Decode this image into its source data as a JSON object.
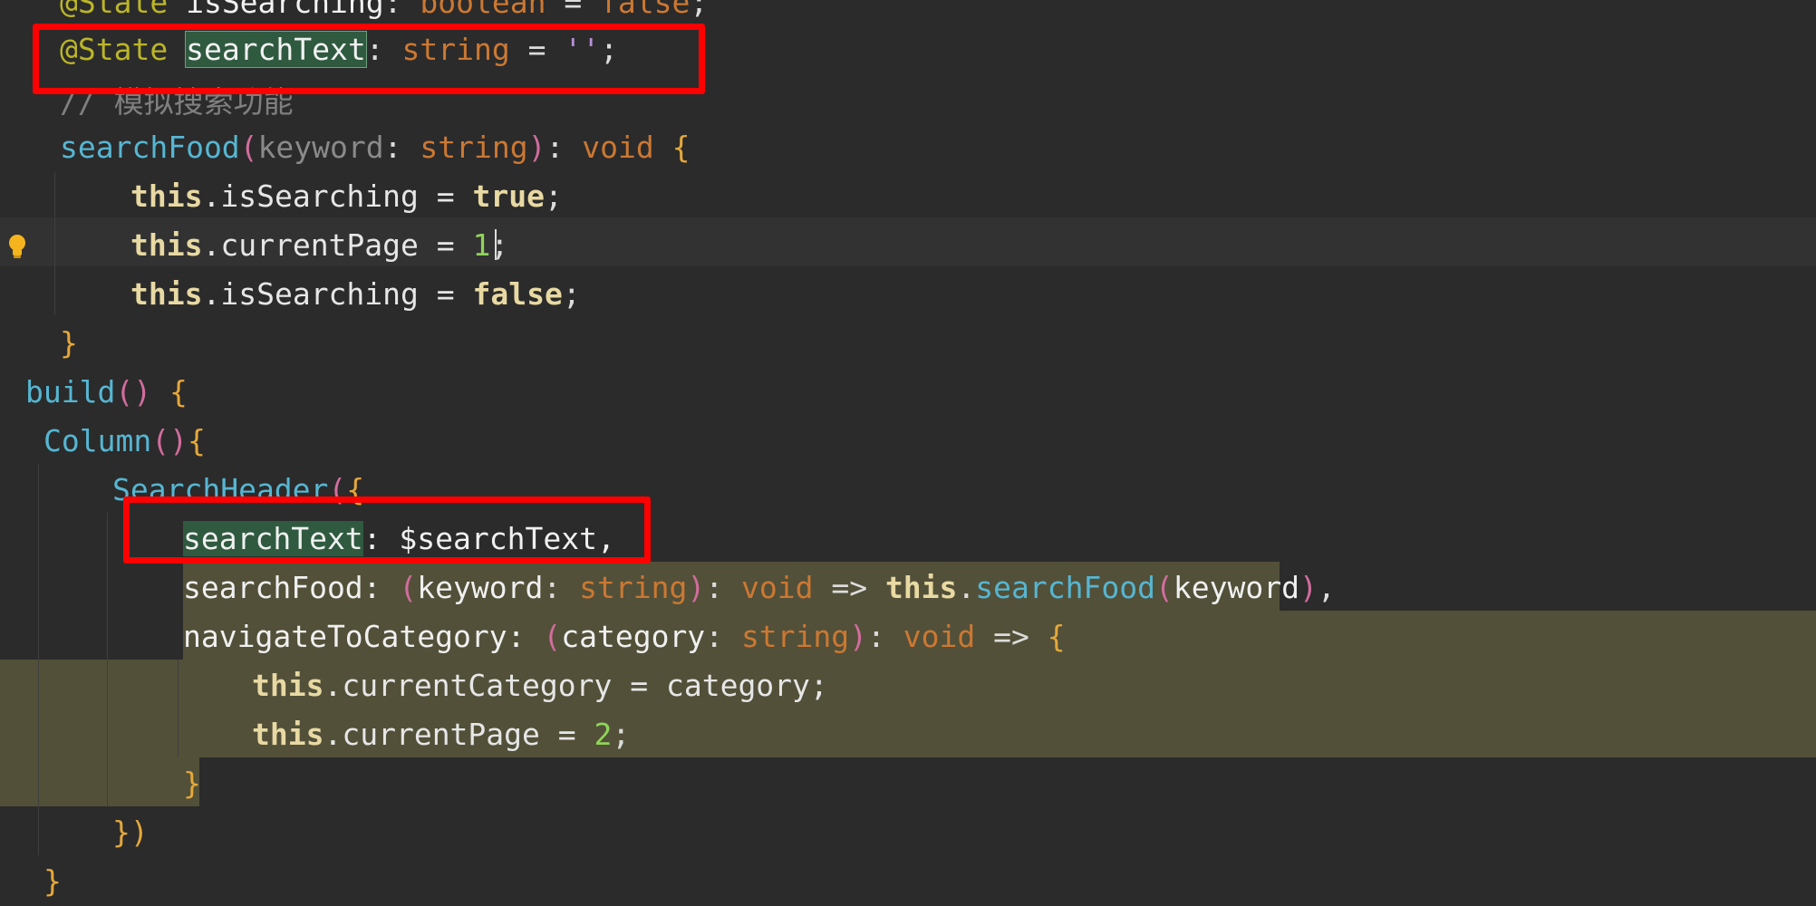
{
  "lines": [
    [
      {
        "t": "@State ",
        "c": "c-ann"
      },
      {
        "t": "isSearching",
        "c": "c-field"
      },
      {
        "t": ": ",
        "c": "c-op"
      },
      {
        "t": "boolean",
        "c": "c-type"
      },
      {
        "t": " = ",
        "c": "c-op"
      },
      {
        "t": "false",
        "c": "c-type"
      },
      {
        "t": ";",
        "c": "c-punc"
      }
    ],
    [
      {
        "t": "@State ",
        "c": "c-ann"
      },
      {
        "t": "searchText",
        "c": "c-field hl-word"
      },
      {
        "t": ": ",
        "c": "c-op"
      },
      {
        "t": "string",
        "c": "c-type"
      },
      {
        "t": " = ",
        "c": "c-op"
      },
      {
        "t": "''",
        "c": "c-str"
      },
      {
        "t": ";",
        "c": "c-punc"
      }
    ],
    [
      {
        "t": "// 模拟搜索功能",
        "c": "c-comment"
      }
    ],
    [
      {
        "t": "searchFood",
        "c": "c-fn"
      },
      {
        "t": "(",
        "c": "c-paren"
      },
      {
        "t": "keyword",
        "c": "c-param"
      },
      {
        "t": ": ",
        "c": "c-op"
      },
      {
        "t": "string",
        "c": "c-type"
      },
      {
        "t": ")",
        "c": "c-paren"
      },
      {
        "t": ": ",
        "c": "c-op"
      },
      {
        "t": "void",
        "c": "c-type"
      },
      {
        "t": " ",
        "c": "c-op"
      },
      {
        "t": "{",
        "c": "c-brace"
      }
    ],
    [
      {
        "t": "this",
        "c": "c-kw"
      },
      {
        "t": ".isSearching = ",
        "c": "c-prop"
      },
      {
        "t": "true",
        "c": "c-kw"
      },
      {
        "t": ";",
        "c": "c-punc"
      }
    ],
    [
      {
        "t": "this",
        "c": "c-kw"
      },
      {
        "t": ".currentPage = ",
        "c": "c-prop"
      },
      {
        "t": "1",
        "c": "c-num"
      },
      {
        "t": ";",
        "c": "c-punc"
      }
    ],
    [
      {
        "t": "this",
        "c": "c-kw"
      },
      {
        "t": ".isSearching = ",
        "c": "c-prop"
      },
      {
        "t": "false",
        "c": "c-kw"
      },
      {
        "t": ";",
        "c": "c-punc"
      }
    ],
    [
      {
        "t": "}",
        "c": "c-brace"
      }
    ],
    [
      {
        "t": "build",
        "c": "c-fn"
      },
      {
        "t": "()",
        "c": "c-paren"
      },
      {
        "t": " ",
        "c": "c-op"
      },
      {
        "t": "{",
        "c": "c-brace"
      }
    ],
    [
      {
        "t": "Column",
        "c": "c-fn"
      },
      {
        "t": "()",
        "c": "c-paren"
      },
      {
        "t": "{",
        "c": "c-brace"
      }
    ],
    [
      {
        "t": "SearchHeader",
        "c": "c-fn"
      },
      {
        "t": "(",
        "c": "c-paren"
      },
      {
        "t": "{",
        "c": "c-brace"
      }
    ],
    [
      {
        "t": "searchText",
        "c": "c-plain hl-word2"
      },
      {
        "t": ": $searchText,",
        "c": "c-plain"
      }
    ],
    [
      {
        "t": "searchFood: ",
        "c": "c-plain"
      },
      {
        "t": "(",
        "c": "c-paren"
      },
      {
        "t": "keyword",
        "c": "c-plain"
      },
      {
        "t": ": ",
        "c": "c-op"
      },
      {
        "t": "string",
        "c": "c-type"
      },
      {
        "t": ")",
        "c": "c-paren"
      },
      {
        "t": ": ",
        "c": "c-op"
      },
      {
        "t": "void",
        "c": "c-type"
      },
      {
        "t": " => ",
        "c": "c-op"
      },
      {
        "t": "this",
        "c": "c-kw"
      },
      {
        "t": ".",
        "c": "c-op"
      },
      {
        "t": "searchFood",
        "c": "c-fn"
      },
      {
        "t": "(",
        "c": "c-paren"
      },
      {
        "t": "keyword",
        "c": "c-plain"
      },
      {
        "t": ")",
        "c": "c-paren"
      },
      {
        "t": ",",
        "c": "c-punc"
      }
    ],
    [
      {
        "t": "navigateToCategory: ",
        "c": "c-plain"
      },
      {
        "t": "(",
        "c": "c-paren"
      },
      {
        "t": "category",
        "c": "c-plain"
      },
      {
        "t": ": ",
        "c": "c-op"
      },
      {
        "t": "string",
        "c": "c-type"
      },
      {
        "t": ")",
        "c": "c-paren"
      },
      {
        "t": ": ",
        "c": "c-op"
      },
      {
        "t": "void",
        "c": "c-type"
      },
      {
        "t": " => ",
        "c": "c-op"
      },
      {
        "t": "{",
        "c": "c-brace"
      }
    ],
    [
      {
        "t": "this",
        "c": "c-kw"
      },
      {
        "t": ".currentCategory = category;",
        "c": "c-prop"
      }
    ],
    [
      {
        "t": "this",
        "c": "c-kw"
      },
      {
        "t": ".currentPage = ",
        "c": "c-prop"
      },
      {
        "t": "2",
        "c": "c-num"
      },
      {
        "t": ";",
        "c": "c-punc"
      }
    ],
    [
      {
        "t": "}",
        "c": "c-brace"
      }
    ],
    [
      {
        "t": "})",
        "c": "c-brace"
      }
    ],
    [
      {
        "t": "}",
        "c": "c-brace"
      }
    ]
  ],
  "colors": {
    "background": "#2b2b2b",
    "highlight_box": "#ff0000",
    "selection": "#525039",
    "word_highlight": "#2f5a3f"
  }
}
